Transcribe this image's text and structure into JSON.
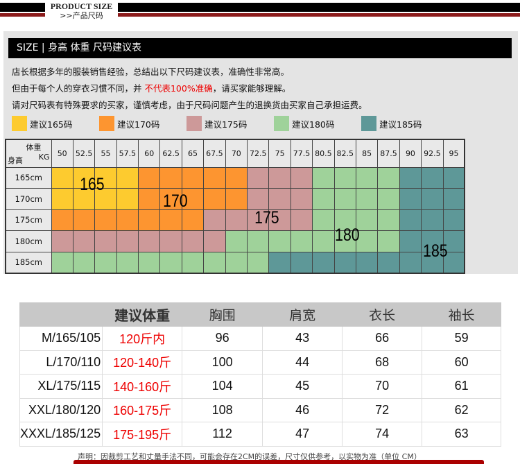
{
  "banner": {
    "title": "PRODUCT SIZE",
    "subtitle": ">>产品尺码"
  },
  "section": {
    "title": "SIZE | 身高 体重 尺码建议表",
    "notes": [
      "店长根据多年的服装销售经验，总结出以下尺码建议表，准确性非常高。",
      "但由于每个人的穿衣习惯不同，并 ",
      "不代表100%准确",
      "，请买家能够理解。",
      "请对尺码表有特殊要求的买家，谨慎考虑，由于尺码问题产生的退换货由买家自己承担运费。"
    ],
    "legend": [
      {
        "label": "建议165码",
        "color": "#fdcb2f"
      },
      {
        "label": "建议170码",
        "color": "#fd9530"
      },
      {
        "label": "建议175码",
        "color": "#cd9999"
      },
      {
        "label": "建议180码",
        "color": "#9fd29a"
      },
      {
        "label": "建议185码",
        "color": "#5e9898"
      }
    ]
  },
  "grid": {
    "corner_weight": "体重",
    "corner_unit": "KG",
    "corner_height": "身高",
    "weights": [
      "50",
      "52.5",
      "55",
      "57.5",
      "60",
      "62.5",
      "65",
      "67.5",
      "70",
      "72.5",
      "75",
      "77.5",
      "80.5",
      "82.5",
      "85",
      "87.5",
      "90",
      "92.5",
      "95"
    ],
    "heights": [
      "165cm",
      "170cm",
      "175cm",
      "180cm",
      "185cm"
    ],
    "cells": [
      "YYYYOOOOOPPPGGGGTTT",
      "YYYYOOOOOPPPGGGGTTT",
      "OOOOOOOPPPPPGGGGTTT",
      "PPPPPPPPGGGGGGGGTTT",
      "GGGGGGGGGGTTTTTTTTT"
    ],
    "zone_labels": [
      "165",
      "170",
      "175",
      "180",
      "185"
    ]
  },
  "sizes": {
    "headers": [
      "",
      "建议体重",
      "胸围",
      "肩宽",
      "衣长",
      "袖长"
    ],
    "rows": [
      [
        "M/165/105",
        "120斤内",
        "96",
        "43",
        "66",
        "59"
      ],
      [
        "L/170/110",
        "120-140斤",
        "100",
        "44",
        "68",
        "60"
      ],
      [
        "XL/175/115",
        "140-160斤",
        "104",
        "45",
        "70",
        "61"
      ],
      [
        "XXL/180/120",
        "160-175斤",
        "108",
        "46",
        "72",
        "62"
      ],
      [
        "XXXL/185/125",
        "175-195斤",
        "112",
        "47",
        "74",
        "63"
      ]
    ]
  },
  "footnote": "声明：因裁剪工艺和丈量手法不同，可能会存在2CM的误差，尺寸仅供参考，以实物为准（单位 CM）"
}
